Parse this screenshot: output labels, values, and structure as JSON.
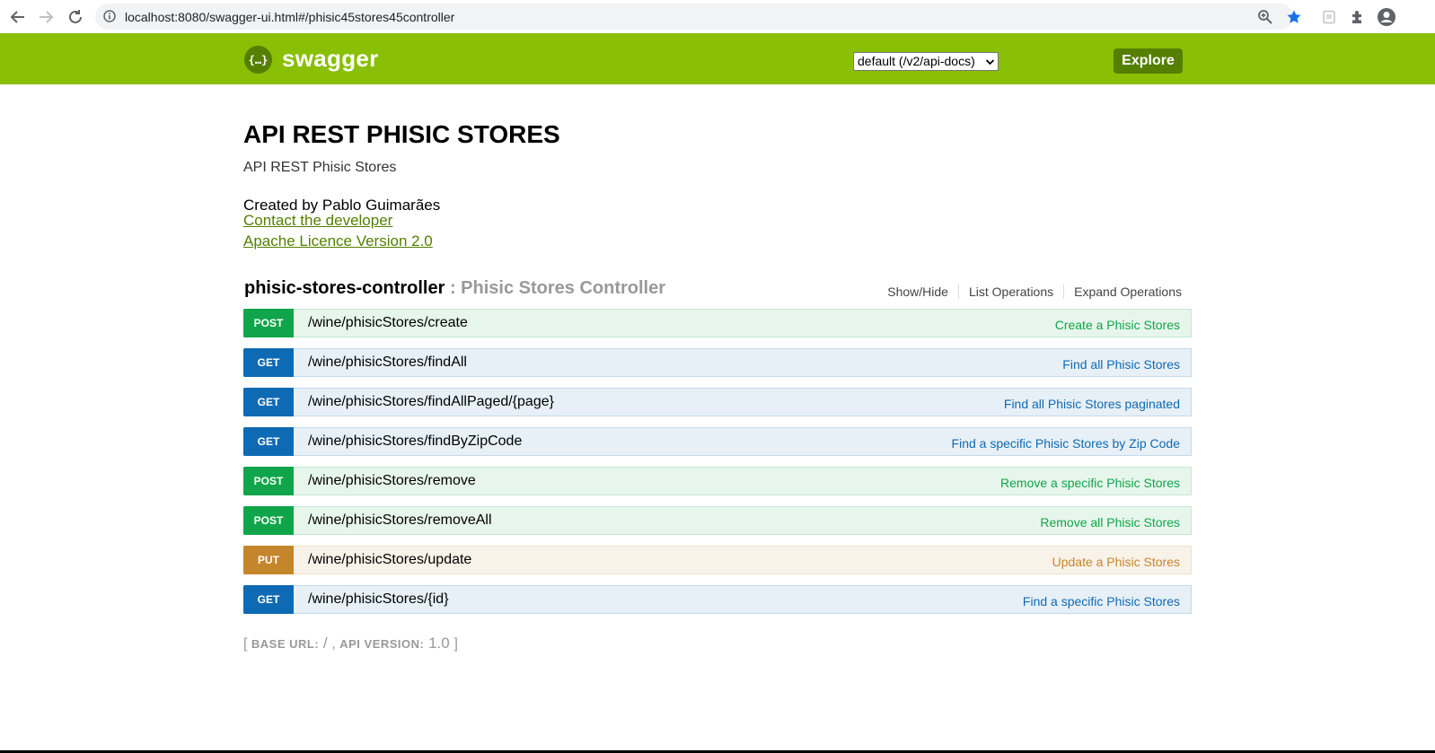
{
  "browser": {
    "url": "localhost:8080/swagger-ui.html#/phisic45stores45controller"
  },
  "header": {
    "logo_glyph": "{…}",
    "logo_text": "swagger",
    "spec_select": "default (/v2/api-docs)",
    "explore_label": "Explore",
    "brand_color": "#89bf04"
  },
  "info": {
    "title": "API REST PHISIC STORES",
    "description": "API REST Phisic Stores",
    "created_by": "Created by Pablo Guimarães",
    "contact_link": "Contact the developer",
    "license_link": "Apache Licence Version 2.0"
  },
  "resource": {
    "name": "phisic-stores-controller",
    "separator": " : ",
    "description": "Phisic Stores Controller",
    "actions": [
      "Show/Hide",
      "List Operations",
      "Expand Operations"
    ]
  },
  "operations": [
    {
      "method": "POST",
      "path": "/wine/phisicStores/create",
      "summary": "Create a Phisic Stores"
    },
    {
      "method": "GET",
      "path": "/wine/phisicStores/findAll",
      "summary": "Find all Phisic Stores"
    },
    {
      "method": "GET",
      "path": "/wine/phisicStores/findAllPaged/{page}",
      "summary": "Find all Phisic Stores paginated"
    },
    {
      "method": "GET",
      "path": "/wine/phisicStores/findByZipCode",
      "summary": "Find a specific Phisic Stores by Zip Code"
    },
    {
      "method": "POST",
      "path": "/wine/phisicStores/remove",
      "summary": "Remove a specific Phisic Stores"
    },
    {
      "method": "POST",
      "path": "/wine/phisicStores/removeAll",
      "summary": "Remove all Phisic Stores"
    },
    {
      "method": "PUT",
      "path": "/wine/phisicStores/update",
      "summary": "Update a Phisic Stores"
    },
    {
      "method": "GET",
      "path": "/wine/phisicStores/{id}",
      "summary": "Find a specific Phisic Stores"
    }
  ],
  "footer": {
    "open_bracket": "[ ",
    "base_url_label": "BASE URL:",
    "base_url_value": " / ",
    "sep": ", ",
    "api_version_label": "API VERSION:",
    "api_version_value": " 1.0 ",
    "close_bracket": "]"
  },
  "method_colors": {
    "POST": "#10a54a",
    "GET": "#0f6ab4",
    "PUT": "#c5862b"
  }
}
